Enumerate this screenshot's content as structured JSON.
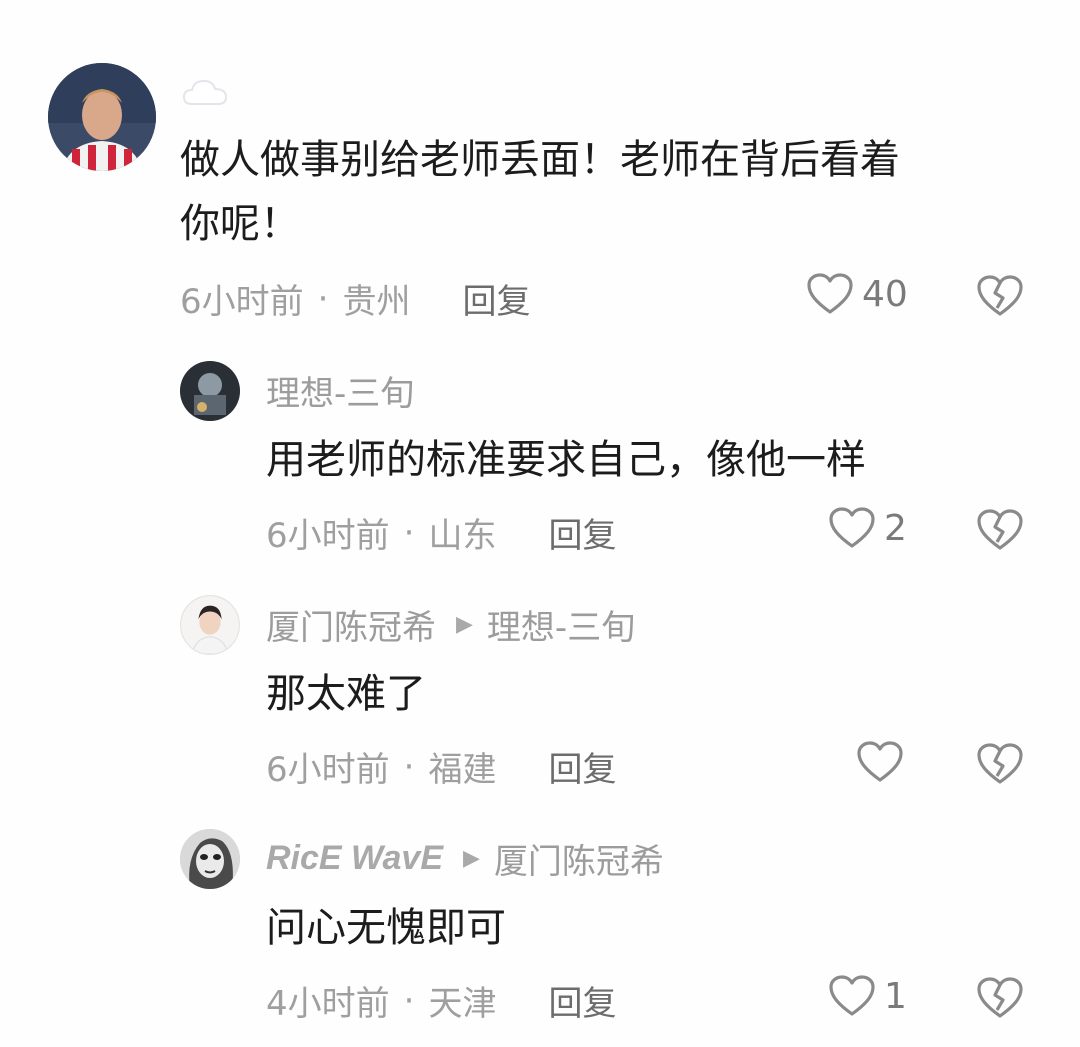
{
  "comments": [
    {
      "author": "",
      "text_line1": "做人做事别给老师丢面！老师在背后看着",
      "text_line2": "你呢！",
      "time": "6小时前",
      "location": "贵州",
      "reply_label": "回复",
      "likes": "40",
      "avatar_icon": "football-player-avatar"
    },
    {
      "author": "理想-三旬",
      "text": "用老师的标准要求自己，像他一样",
      "time": "6小时前",
      "location": "山东",
      "reply_label": "回复",
      "likes": "2"
    },
    {
      "author": "厦门陈冠希",
      "reply_to": "理想-三旬",
      "text": "那太难了",
      "time": "6小时前",
      "location": "福建",
      "reply_label": "回复",
      "likes": ""
    },
    {
      "author": "RicE WavE",
      "reply_to": "厦门陈冠希",
      "text": "问心无愧即可",
      "time": "4小时前",
      "location": "天津",
      "reply_label": "回复",
      "likes": "1"
    }
  ],
  "separator": "·",
  "colors": {
    "text": "#1c1c1c",
    "meta": "#9f9f9f",
    "reply": "#6c6c6c",
    "icon": "#8a8a8a"
  }
}
